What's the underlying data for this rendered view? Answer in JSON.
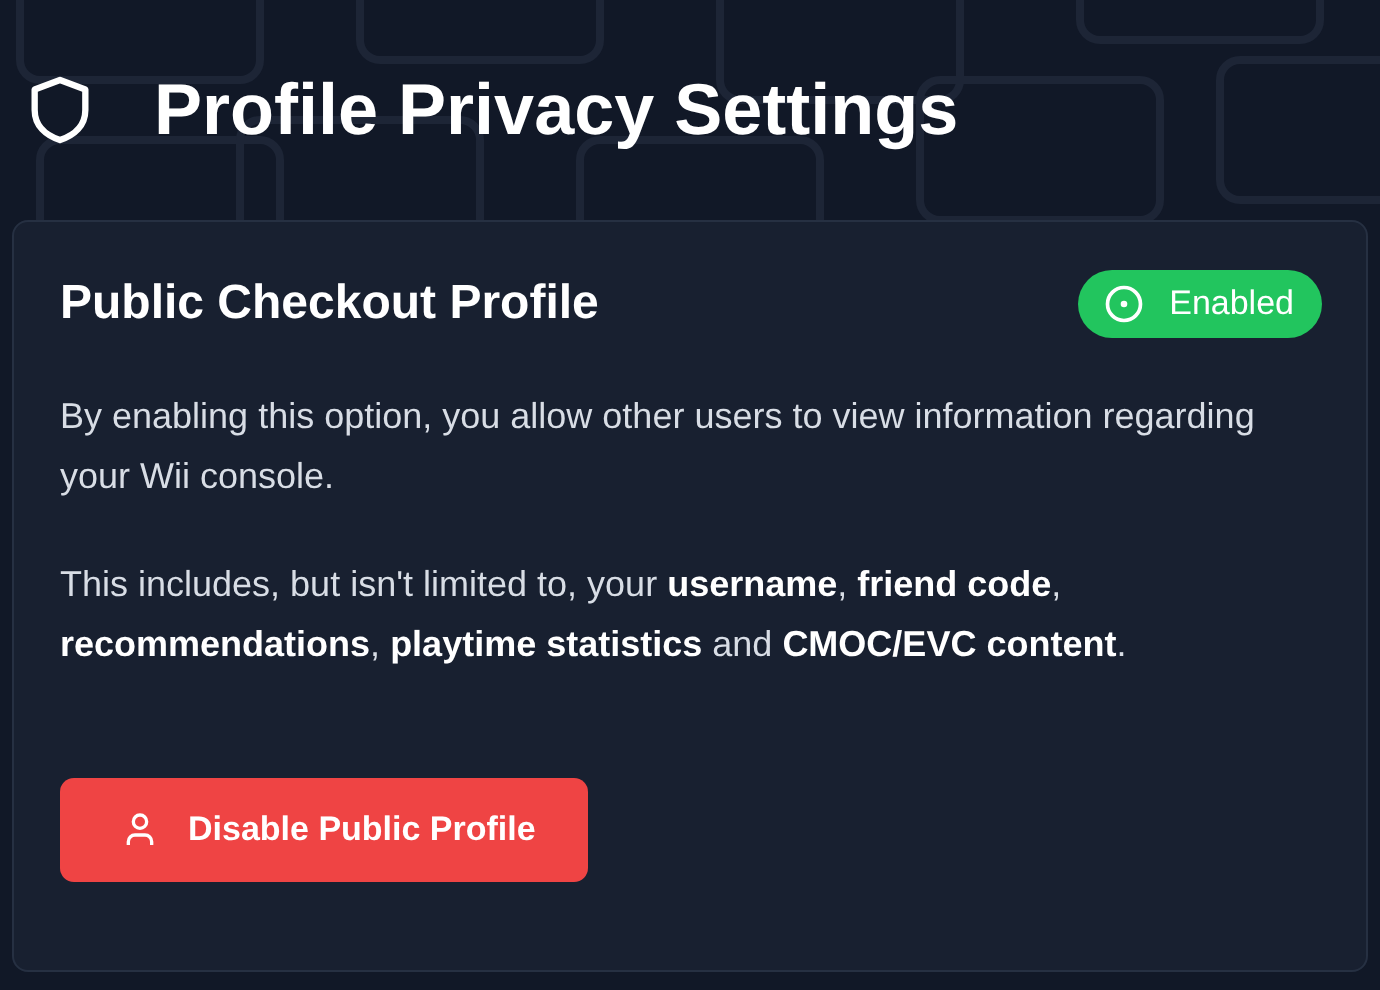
{
  "header": {
    "title": "Profile Privacy Settings"
  },
  "card": {
    "title": "Public Checkout Profile",
    "status": {
      "label": "Enabled",
      "enabled": true
    },
    "paragraphs": [
      "By enabling this option, you allow other users to view information regarding your Wii console.",
      "This includes, but isn't limited to, your **username**, **friend code**, **recommendations**, **playtime statistics** and **CMOC/EVC content**."
    ],
    "button": {
      "label": "Disable Public Profile"
    }
  }
}
